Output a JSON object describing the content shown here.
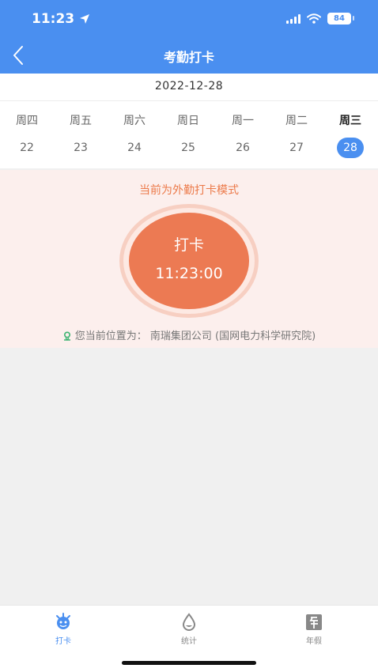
{
  "status_bar": {
    "time": "11:23",
    "battery": "84"
  },
  "header": {
    "title": "考勤打卡"
  },
  "date": "2022-12-28",
  "week": [
    {
      "weekday": "周四",
      "day": "22"
    },
    {
      "weekday": "周五",
      "day": "23"
    },
    {
      "weekday": "周六",
      "day": "24"
    },
    {
      "weekday": "周日",
      "day": "25"
    },
    {
      "weekday": "周一",
      "day": "26"
    },
    {
      "weekday": "周二",
      "day": "27"
    },
    {
      "weekday": "周三",
      "day": "28"
    }
  ],
  "punch": {
    "mode_text": "当前为外勤打卡模式",
    "button_label": "打卡",
    "time": "11:23:00",
    "location": "您当前位置为：  南瑞集团公司 (国网电力科学研究院)"
  },
  "tabs": [
    {
      "label": "打卡",
      "icon": "punch-icon"
    },
    {
      "label": "统计",
      "icon": "statistics-icon"
    },
    {
      "label": "年假",
      "icon": "annual-leave-icon"
    }
  ],
  "colors": {
    "primary": "#4a8ff0",
    "accent": "#ec7a53",
    "panel": "#fcefed"
  }
}
